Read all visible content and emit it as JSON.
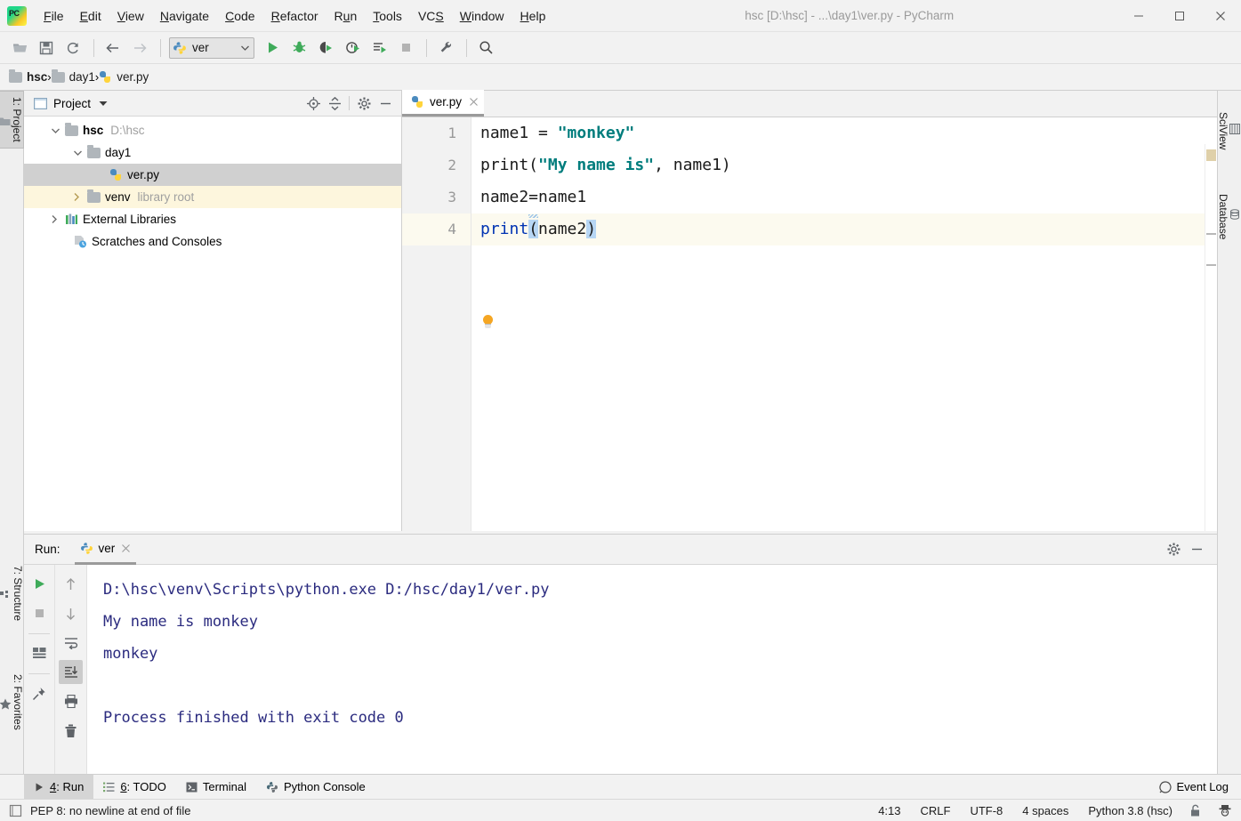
{
  "window": {
    "title": "hsc [D:\\hsc] - ...\\day1\\ver.py - PyCharm",
    "minimize": "–",
    "maximize": "□",
    "close": "✕"
  },
  "menubar": {
    "items": [
      {
        "label": "File"
      },
      {
        "label": "Edit"
      },
      {
        "label": "View"
      },
      {
        "label": "Navigate"
      },
      {
        "label": "Code"
      },
      {
        "label": "Refactor"
      },
      {
        "label": "Run"
      },
      {
        "label": "Tools"
      },
      {
        "label": "VCS"
      },
      {
        "label": "Window"
      },
      {
        "label": "Help"
      }
    ]
  },
  "toolbar": {
    "open_icon": "open-folder-icon",
    "save_icon": "save-icon",
    "sync_icon": "sync-icon",
    "back_icon": "back-arrow-icon",
    "forward_icon": "forward-arrow-icon",
    "run_config": "ver",
    "run_config_chevron": "⌄",
    "run_icon": "run-icon",
    "debug_icon": "debug-icon",
    "coverage_icon": "run-with-coverage-icon",
    "profile_icon": "profile-icon",
    "run_tests_icon": "run-multiple-icon",
    "stop_icon": "stop-icon",
    "settings_icon": "wrench-icon",
    "search_icon": "search-icon"
  },
  "breadcrumb": {
    "items": [
      {
        "label": "hsc",
        "icon": "folder-icon",
        "bold": true
      },
      {
        "label": "day1",
        "icon": "folder-icon",
        "bold": false
      },
      {
        "label": "ver.py",
        "icon": "python-file-icon",
        "bold": false
      }
    ],
    "separator": "›"
  },
  "left_strip": {
    "project": "1: Project",
    "structure": "7: Structure",
    "favorites": "2: Favorites"
  },
  "right_strip": {
    "sciview": "SciView",
    "database": "Database"
  },
  "project_panel": {
    "title": "Project",
    "caret": "▼",
    "actions": [
      "locate-icon",
      "collapse-all-icon",
      "gear-icon",
      "hide-icon"
    ],
    "tree": [
      {
        "indent": 0,
        "arrow": "⌄",
        "icon": "folder-icon",
        "label": "hsc",
        "bold": true,
        "sub": "D:\\hsc",
        "state": "normal"
      },
      {
        "indent": 1,
        "arrow": "⌄",
        "icon": "folder-icon",
        "label": "day1",
        "bold": false,
        "sub": "",
        "state": "normal"
      },
      {
        "indent": 2,
        "arrow": "",
        "icon": "python-file-icon",
        "label": "ver.py",
        "bold": false,
        "sub": "",
        "state": "selected"
      },
      {
        "indent": 1,
        "arrow": "›",
        "icon": "folder-icon",
        "label": "venv",
        "bold": false,
        "sub": "library root",
        "state": "library"
      },
      {
        "indent": 0,
        "arrow": "›",
        "icon": "external-libraries-icon",
        "label": "External Libraries",
        "bold": false,
        "sub": "",
        "state": "normal"
      },
      {
        "indent": 0,
        "arrow": "",
        "icon": "scratches-icon",
        "label": "Scratches and Consoles",
        "bold": false,
        "sub": "",
        "state": "normal"
      }
    ]
  },
  "editor": {
    "tab": {
      "label": "ver.py",
      "icon": "python-file-icon",
      "close": "✕"
    },
    "line_numbers": [
      "1",
      "2",
      "3",
      "4"
    ],
    "lines": [
      {
        "n": 1,
        "text": "name1 = \"monkey\"",
        "highlighted": false
      },
      {
        "n": 2,
        "text": "print(\"My name is\", name1)",
        "highlighted": false
      },
      {
        "n": 3,
        "text": "name2=name1",
        "highlighted": false
      },
      {
        "n": 4,
        "text": "print(name2)",
        "highlighted": true
      }
    ],
    "inspection_bulb": "lightbulb-icon",
    "marker_color": "#d9c89a"
  },
  "run_panel": {
    "label": "Run:",
    "tab": {
      "name": "ver",
      "icon": "python-icon",
      "close": "✕"
    },
    "header_actions": [
      "gear-icon",
      "hide-icon"
    ],
    "tools_left": [
      "rerun-icon",
      "stop-icon",
      "layout-icon",
      "pin-icon"
    ],
    "tools_right": [
      "up-arrow-icon",
      "down-arrow-icon",
      "soft-wrap-icon",
      "scroll-to-end-icon",
      "print-icon",
      "trash-icon"
    ],
    "console": [
      "D:\\hsc\\venv\\Scripts\\python.exe D:/hsc/day1/ver.py",
      "My name is monkey",
      "monkey",
      "",
      "Process finished with exit code 0"
    ]
  },
  "bottom_tabs": {
    "items": [
      {
        "label": "4: Run",
        "icon": "run-icon",
        "selected": true
      },
      {
        "label": "6: TODO",
        "icon": "todo-icon",
        "selected": false
      },
      {
        "label": "Terminal",
        "icon": "terminal-icon",
        "selected": false
      },
      {
        "label": "Python Console",
        "icon": "python-icon",
        "selected": false
      }
    ],
    "event_log": {
      "label": "Event Log",
      "icon": "event-log-icon"
    }
  },
  "status_bar": {
    "message": "PEP 8: no newline at end of file",
    "message_icon": "inspection-icon",
    "caret_position": "4:13",
    "line_separator": "CRLF",
    "encoding": "UTF-8",
    "indent": "4 spaces",
    "interpreter": "Python 3.8 (hsc)",
    "lock_icon": "unlocked-icon",
    "hector_icon": "hector-hat-icon"
  }
}
